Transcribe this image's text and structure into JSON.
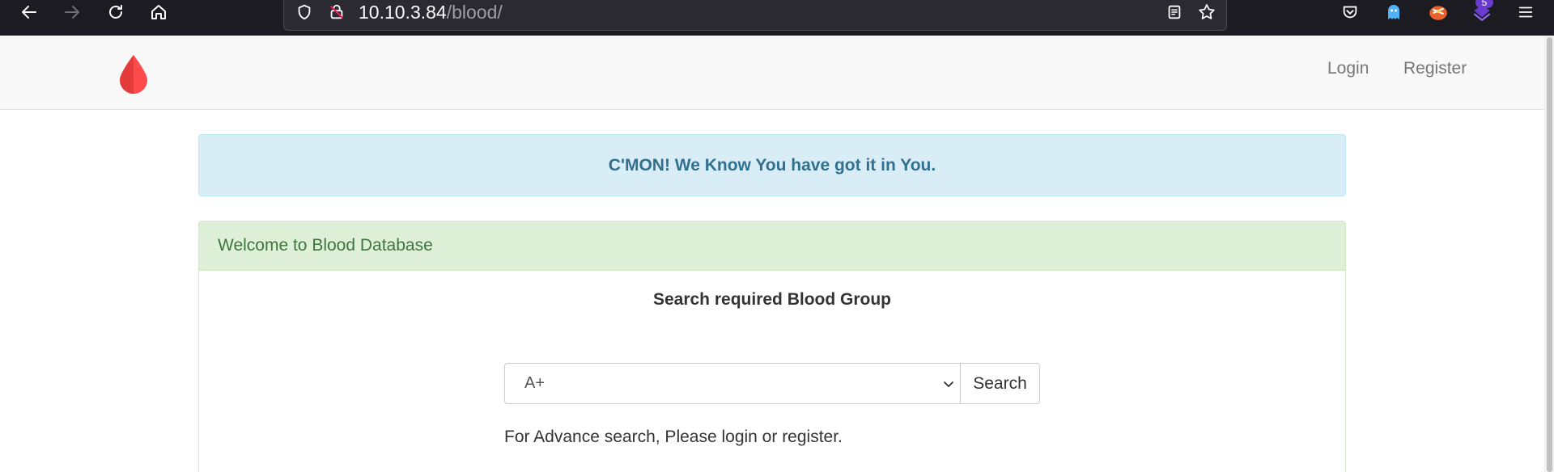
{
  "browser": {
    "url_host": "10.10.3.84",
    "url_path": "/blood/",
    "extension_badge": "5"
  },
  "navbar": {
    "login_label": "Login",
    "register_label": "Register",
    "brand_color": "#ff4b4b"
  },
  "alert": {
    "text": "C'MON! We Know You have got it in You."
  },
  "panel": {
    "heading": "Welcome to Blood Database",
    "subtitle": "Search required Blood Group",
    "select": {
      "value": "A+"
    },
    "search_label": "Search",
    "advance_note": "For Advance search, Please login or register."
  }
}
